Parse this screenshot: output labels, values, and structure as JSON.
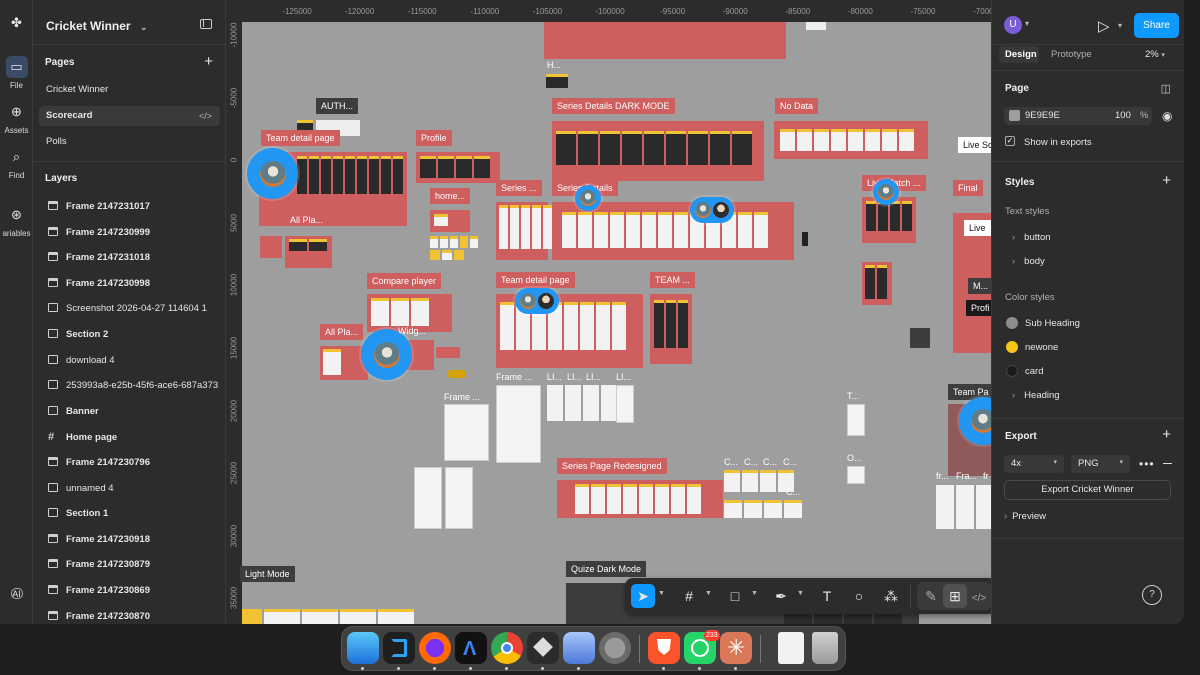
{
  "file": {
    "name": "Cricket Winner",
    "caret": "⌄"
  },
  "rail": [
    {
      "label": "File",
      "icon": "file-icon"
    },
    {
      "label": "Assets",
      "icon": "assets-icon"
    },
    {
      "label": "Find",
      "icon": "search-icon"
    },
    {
      "label": "ariables",
      "icon": "variables-icon"
    }
  ],
  "pages": {
    "title": "Pages",
    "items": [
      "Cricket Winner",
      "Scorecard",
      "Polls"
    ],
    "selected_code": "</>"
  },
  "layers": {
    "title": "Layers",
    "items": [
      {
        "label": "Frame 2147231017",
        "kind": "frame",
        "bold": true
      },
      {
        "label": "Frame 2147230999",
        "kind": "frame",
        "bold": true
      },
      {
        "label": "Frame 2147231018",
        "kind": "frame",
        "bold": true
      },
      {
        "label": "Frame 2147230998",
        "kind": "frame",
        "bold": true
      },
      {
        "label": "Screenshot 2026-04-27 114604 1",
        "kind": "image",
        "bold": false
      },
      {
        "label": "Section 2",
        "kind": "section",
        "bold": true
      },
      {
        "label": "download 4",
        "kind": "image",
        "bold": false
      },
      {
        "label": "253993a8-e25b-45f6-ace6-687a373",
        "kind": "image",
        "bold": false
      },
      {
        "label": "Banner",
        "kind": "section",
        "bold": true
      },
      {
        "label": "Home page",
        "kind": "hash",
        "bold": true
      },
      {
        "label": "Frame 2147230796",
        "kind": "frame",
        "bold": true
      },
      {
        "label": "unnamed 4",
        "kind": "image",
        "bold": false
      },
      {
        "label": "Section 1",
        "kind": "section",
        "bold": true
      },
      {
        "label": "Frame 2147230918",
        "kind": "frame",
        "bold": true
      },
      {
        "label": "Frame 2147230879",
        "kind": "frame",
        "bold": true
      },
      {
        "label": "Frame 2147230869",
        "kind": "frame",
        "bold": true
      },
      {
        "label": "Frame 2147230870",
        "kind": "frame",
        "bold": true
      }
    ]
  },
  "ruler": {
    "x": [
      "-125000",
      "-120000",
      "-115000",
      "-110000",
      "-105000",
      "-100000",
      "-95000",
      "-90000",
      "-85000",
      "-80000",
      "-75000",
      "-70000"
    ],
    "y": [
      "-10000",
      "-5000",
      "0",
      "5000",
      "10000",
      "15000",
      "20000",
      "25000",
      "30000",
      "35000"
    ]
  },
  "canvas_labels": {
    "auth": "AUTH...",
    "team_detail_1": "Team detail page",
    "profile": "Profile",
    "series_dark": "Series Details DARK MODE",
    "no_data": "No Data",
    "live_sc": "Live Sc",
    "h": "H...",
    "home": "home...",
    "series": "Series ...",
    "series_details": "Series Details",
    "live_match": "Live Match ...",
    "final": "Final",
    "all_pla_1": "All Pla...",
    "compare": "Compare player",
    "team_detail_2": "Team detail page",
    "team": "TEAM ...",
    "live": "Live",
    "m": "M...",
    "profi": "Profi",
    "all_pla_2": "All Pla...",
    "widg": "Widg...",
    "frame_a": "Frame ...",
    "frame_b": "Frame ...",
    "li1": "LI...",
    "li2": "LI...",
    "li3": "LI...",
    "li4": "LI...",
    "team_pa": "Team Pa",
    "t": "T...",
    "series_redesign": "Series Page Redesigned",
    "c1": "C...",
    "c2": "C...",
    "c3": "C...",
    "c4": "C...",
    "c5": "C...",
    "o": "O...",
    "fr1": "fr...",
    "fr2": "Fra...",
    "fr3": "fr",
    "light_mode": "Light Mode",
    "quize_dark": "Quize Dark Mode"
  },
  "toolbar": {
    "tools": [
      "move-tool",
      "frame-tool",
      "shape-tool",
      "pen-tool",
      "text-tool",
      "comment-tool",
      "actions-tool",
      "draw-toggle",
      "design-toggle",
      "dev-toggle"
    ]
  },
  "right": {
    "avatar_letter": "U",
    "share_label": "Share",
    "tabs": [
      "Design",
      "Prototype"
    ],
    "zoom": "2%",
    "page_title": "Page",
    "page_color": "9E9E9E",
    "page_opacity": "100",
    "percent": "%",
    "show_exports": "Show in exports",
    "styles_title": "Styles",
    "text_styles_title": "Text styles",
    "text_styles": [
      "button",
      "body"
    ],
    "color_styles_title": "Color styles",
    "color_styles": [
      {
        "name": "Sub Heading",
        "color": "#8d8d8d"
      },
      {
        "name": "newone",
        "color": "#f5c518"
      },
      {
        "name": "card",
        "color": "#1a1a1a"
      }
    ],
    "heading_group": "Heading",
    "export_title": "Export",
    "export_scale": "4x",
    "export_format": "PNG",
    "export_button": "Export Cricket Winner",
    "preview_label": "Preview",
    "help": "?"
  },
  "dock": {
    "whatsapp_badge": "233"
  },
  "colors": {
    "accent": "#0d99ff",
    "frame_red": "#cf5e5e",
    "canvas": "#9e9e9e"
  }
}
